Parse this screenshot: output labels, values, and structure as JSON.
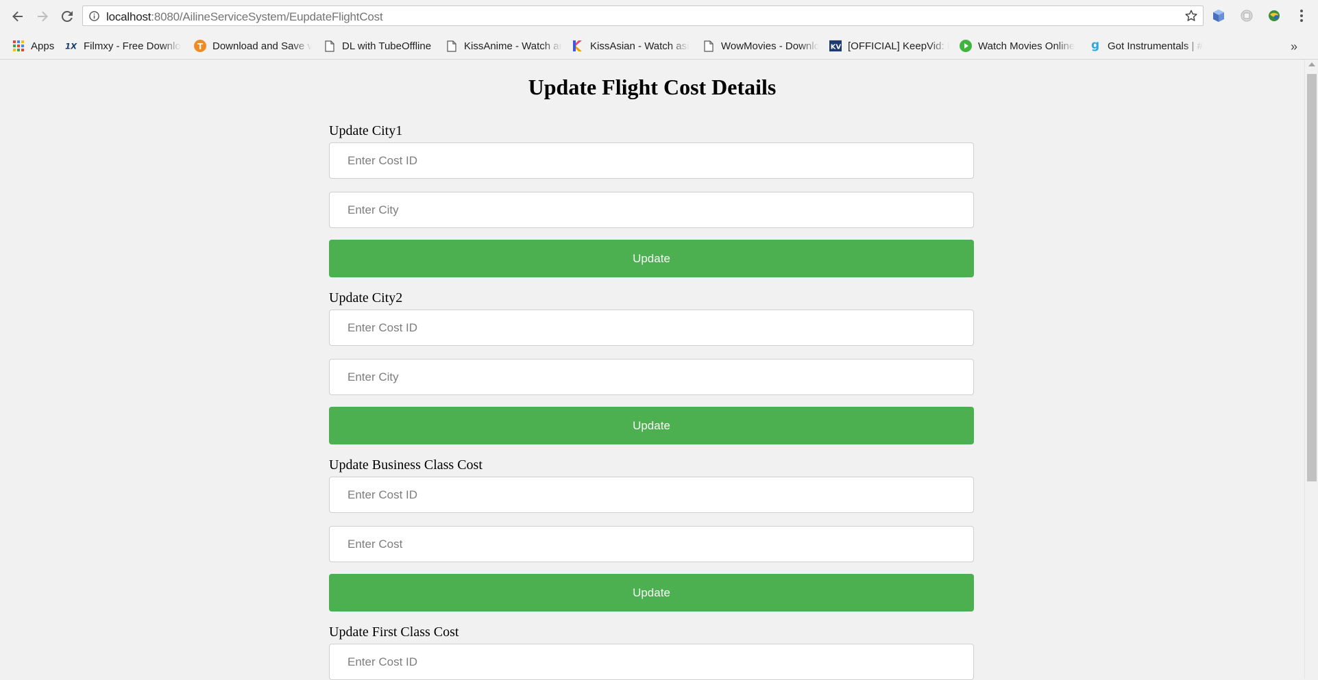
{
  "browser": {
    "url_host": "localhost",
    "url_path": ":8080/AilineServiceSystem/EupdateFlightCost"
  },
  "bookmarks": [
    {
      "label": "Apps",
      "icon": "apps-grid-icon"
    },
    {
      "label": "Filmxy - Free Downlo",
      "icon": "filmxy-icon"
    },
    {
      "label": "Download and Save v",
      "icon": "download-save-icon"
    },
    {
      "label": "DL with TubeOffline",
      "icon": "page-icon"
    },
    {
      "label": "KissAnime - Watch ar",
      "icon": "page-icon"
    },
    {
      "label": "KissAsian - Watch asi",
      "icon": "kissasian-icon"
    },
    {
      "label": "WowMovies - Downlo",
      "icon": "page-icon"
    },
    {
      "label": "[OFFICIAL] KeepVid: D",
      "icon": "keepvid-icon"
    },
    {
      "label": "Watch Movies Online",
      "icon": "play-icon"
    },
    {
      "label": "Got Instrumentals | #",
      "icon": "got-instrumentals-icon"
    }
  ],
  "page": {
    "title": "Update Flight Cost Details",
    "sections": [
      {
        "label": "Update City1",
        "fields": [
          "Enter Cost ID",
          "Enter City"
        ],
        "button": "Update"
      },
      {
        "label": "Update City2",
        "fields": [
          "Enter Cost ID",
          "Enter City"
        ],
        "button": "Update"
      },
      {
        "label": "Update Business Class Cost",
        "fields": [
          "Enter Cost ID",
          "Enter Cost"
        ],
        "button": "Update"
      },
      {
        "label": "Update First Class Cost",
        "fields": [
          "Enter Cost ID"
        ]
      }
    ]
  },
  "colors": {
    "button_green": "#4caf50",
    "page_background": "#f1f1f1"
  }
}
